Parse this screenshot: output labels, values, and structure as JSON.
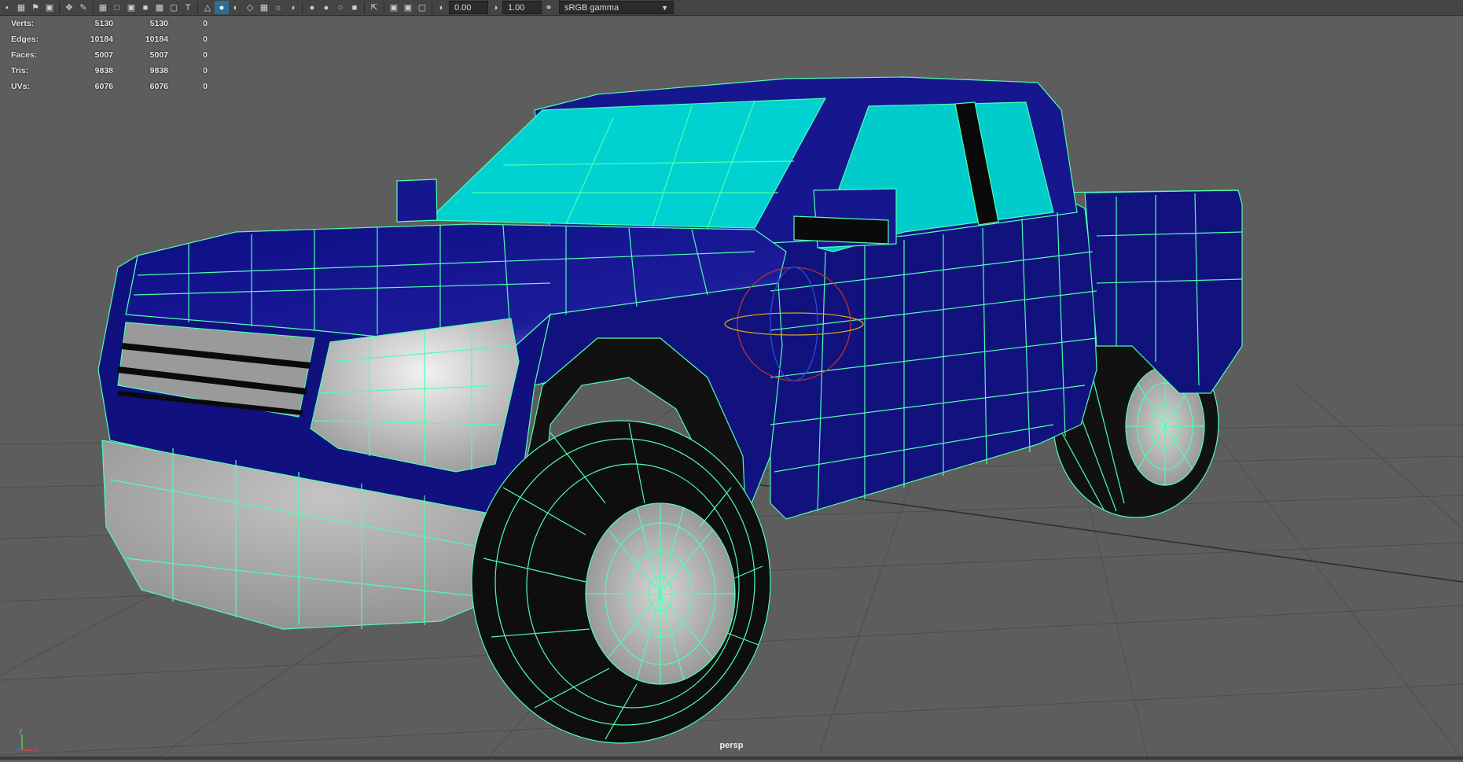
{
  "toolbar": {
    "exposure_value": "0.00",
    "gamma_value": "1.00",
    "color_space": "sRGB gamma",
    "icons": [
      "camera-icon",
      "camera-attrs-icon",
      "bookmark-icon",
      "image-plane-icon",
      "2d-pan-icon",
      "grease-pencil-icon",
      "grid-icon",
      "film-gate-icon",
      "resolution-gate-icon",
      "gate-mask-icon",
      "field-chart-icon",
      "safe-action-icon",
      "safe-title-icon",
      "wireframe-icon",
      "smooth-shade-icon",
      "shade-wireframe-icon",
      "xray-icon",
      "textured-icon",
      "lights-icon",
      "shadows-icon",
      "ambient-occlusion-icon",
      "motion-blur-icon",
      "anti-alias-icon",
      "depth-of-field-icon",
      "isolate-select-icon",
      "xray-joints-icon",
      "xray-active-icon",
      "exposure-icon",
      "gamma-icon",
      "color-mgmt-icon"
    ]
  },
  "hud": {
    "rows": [
      {
        "label": "Verts:",
        "v1": "5130",
        "v2": "5130",
        "v3": "0"
      },
      {
        "label": "Edges:",
        "v1": "10184",
        "v2": "10184",
        "v3": "0"
      },
      {
        "label": "Faces:",
        "v1": "5007",
        "v2": "5007",
        "v3": "0"
      },
      {
        "label": "Tris:",
        "v1": "9838",
        "v2": "9838",
        "v3": "0"
      },
      {
        "label": "UVs:",
        "v1": "6076",
        "v2": "6076",
        "v3": "0"
      }
    ]
  },
  "viewport": {
    "camera_name": "persp",
    "axis_labels": {
      "y": "y",
      "x": "x",
      "z": "z"
    },
    "colors": {
      "background": "#5d5d5d",
      "grid": "#4a4a4a",
      "body_blue": "#1a1a8a",
      "glass_cyan": "#00d0d0",
      "wire": "#4dffb0",
      "chrome": "#a8a8a8",
      "tire": "#111111"
    }
  }
}
